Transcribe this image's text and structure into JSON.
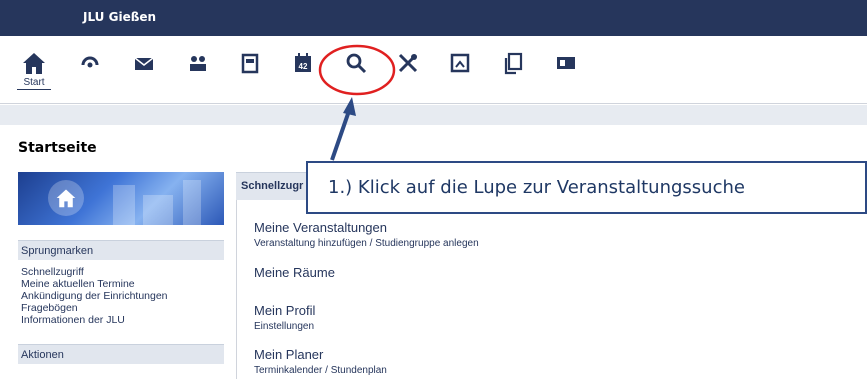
{
  "topbar": {
    "brand": "JLU Gießen"
  },
  "nav": {
    "items": [
      {
        "name": "start",
        "label": "Start",
        "icon": "house-icon"
      },
      {
        "name": "activity",
        "icon": "activity-icon"
      },
      {
        "name": "messages",
        "icon": "envelope-icon"
      },
      {
        "name": "community",
        "icon": "people-icon"
      },
      {
        "name": "profile",
        "icon": "profile-icon"
      },
      {
        "name": "planner",
        "icon": "calendar-icon",
        "badge": "42"
      },
      {
        "name": "search",
        "icon": "magnifier-icon"
      },
      {
        "name": "tools",
        "icon": "tools-icon"
      },
      {
        "name": "admin",
        "icon": "admin-icon"
      },
      {
        "name": "documents",
        "icon": "documents-icon"
      },
      {
        "name": "contents",
        "icon": "contents-icon"
      }
    ]
  },
  "page": {
    "title": "Startseite"
  },
  "sidebar": {
    "jump_heading": "Sprungmarken",
    "jump_links": [
      "Schnellzugriff",
      "Meine aktuellen Termine",
      "Ankündigung der Einrichtungen",
      "Fragebögen",
      "Informationen der JLU"
    ],
    "actions_heading": "Aktionen"
  },
  "content": {
    "heading": "Schnellzugr",
    "entries": [
      {
        "title": "Meine Veranstaltungen",
        "sub": "Veranstaltung hinzufügen / Studiengruppe anlegen"
      },
      {
        "title": "Meine Räume",
        "sub": ""
      },
      {
        "title": "Mein Profil",
        "sub": "Einstellungen"
      },
      {
        "title": "Mein Planer",
        "sub": "Terminkalender / Stundenplan"
      }
    ]
  },
  "callout": {
    "text": "1.) Klick auf die Lupe zur Veranstaltungssuche"
  },
  "colors": {
    "header": "#26365c",
    "highlight": "#e02020",
    "callout_border": "#2d4a84"
  }
}
